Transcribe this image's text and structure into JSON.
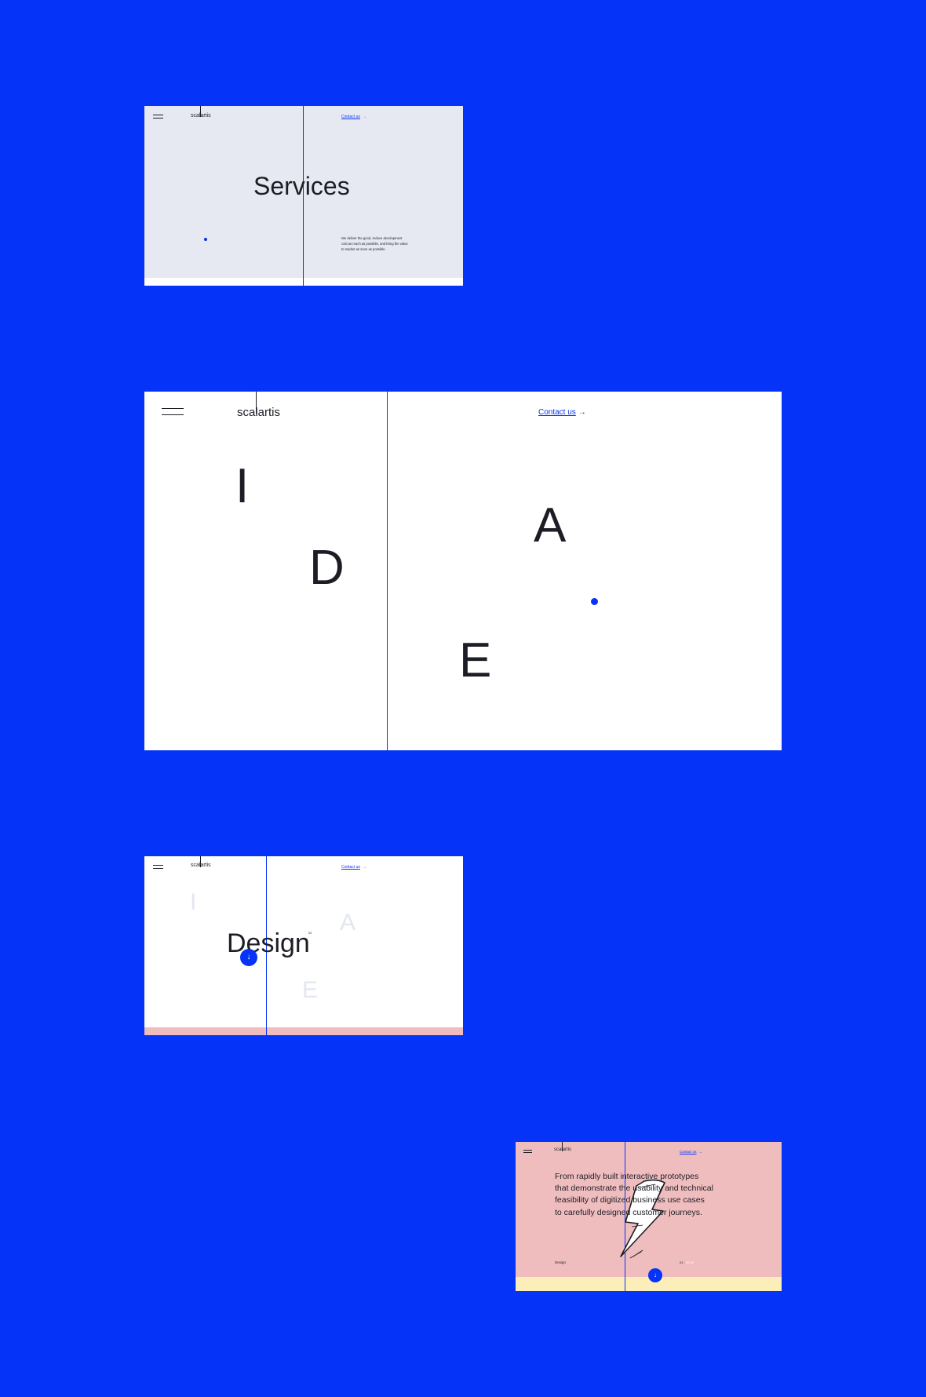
{
  "colors": {
    "background": "#0533f8",
    "accent": "#0533f8",
    "frame1_bg": "#e7e9f2",
    "frame3_strip": "#f0bdbe",
    "frame4_bg": "#f0bdbe",
    "frame4_strip": "#fbeeb9",
    "text": "#1d1d26"
  },
  "frame1": {
    "logo": "scalartis",
    "contact": "Contact us",
    "title": "Services",
    "description": [
      "We deliver the good, reduce development",
      "cost as much as possible, and bring the value",
      "to market as soon as possible."
    ]
  },
  "frame2": {
    "logo": "scalartis",
    "contact": "Contact us",
    "letters": [
      "I",
      "D",
      "A",
      "E"
    ]
  },
  "frame3": {
    "logo": "scalartis",
    "contact": "Contact us",
    "title": "Design",
    "superscript": "02",
    "ghost_letters": [
      "I",
      "A",
      "E"
    ]
  },
  "frame4": {
    "logo": "scalartis",
    "contact": "Contact us",
    "body_lines": [
      "From rapidly built interactive prototypes",
      "that demonstrate the usability and technical",
      "feasibility of digitized business use cases",
      "to carefully designed customer journeys."
    ],
    "footer_label": "Design",
    "pagination": [
      "01",
      "02",
      "03"
    ]
  },
  "icons": {
    "menu": "hamburger-menu-icon",
    "arrow_right": "arrow-right-icon",
    "arrow_down": "arrow-down-icon",
    "lightning": "lightning-bolt-icon"
  }
}
